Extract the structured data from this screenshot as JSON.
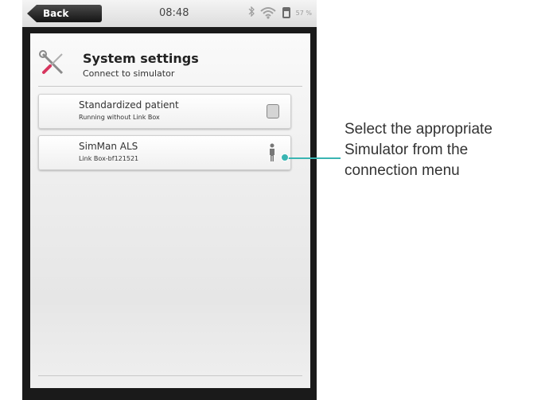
{
  "statusbar": {
    "back_label": "Back",
    "time": "08:48",
    "battery_percent": "57 %",
    "wifi_label": "",
    "icons": [
      "bluetooth-icon",
      "wifi-icon",
      "battery-icon"
    ]
  },
  "header": {
    "title": "System settings",
    "subtitle": "Connect to simulator",
    "icon": "wrench-screwdriver-icon"
  },
  "simulators": [
    {
      "title": "Standardized patient",
      "subtitle": "Running without Link Box",
      "icon": "square-icon"
    },
    {
      "title": "SimMan ALS",
      "subtitle": "Link Box-bf121521",
      "icon": "person-icon"
    }
  ],
  "callout": {
    "lines": [
      "Select the appropriate",
      "Simulator from the",
      "connection menu"
    ],
    "color": "#3ab5b2"
  }
}
